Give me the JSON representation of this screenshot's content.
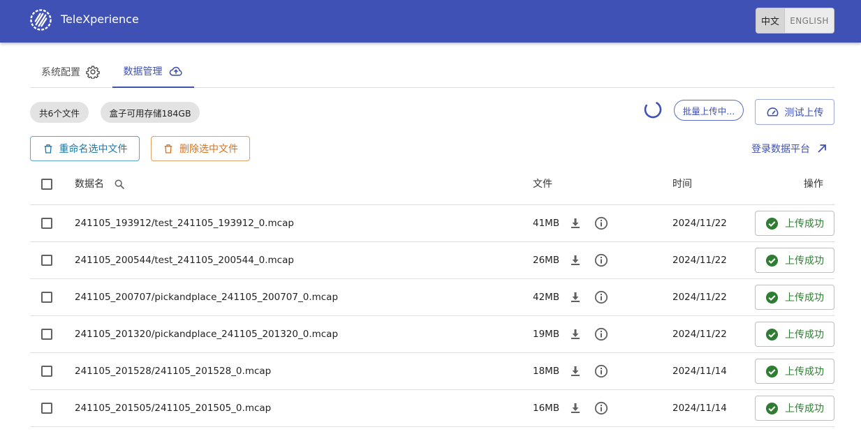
{
  "app": {
    "title": "TeleXperience"
  },
  "language": {
    "options": [
      "中文",
      "ENGLISH"
    ],
    "selected": "中文"
  },
  "tabs": [
    {
      "label": "系统配置",
      "icon": "gear-icon",
      "active": false
    },
    {
      "label": "数据管理",
      "icon": "cloud-upload-icon",
      "active": true
    }
  ],
  "summary": {
    "file_count": "共6个文件",
    "storage": "盒子可用存储184GB"
  },
  "upload": {
    "batch_label": "批量上传中...",
    "test_label": "测试上传"
  },
  "actions": {
    "rename_label": "重命名选中文件",
    "delete_label": "删除选中文件",
    "login_label": "登录数据平台"
  },
  "table": {
    "headers": {
      "name": "数据名",
      "file": "文件",
      "time": "时间",
      "op": "操作"
    },
    "rows": [
      {
        "name": "241105_193912/test_241105_193912_0.mcap",
        "size": "41MB",
        "time": "2024/11/22",
        "status": "上传成功"
      },
      {
        "name": "241105_200544/test_241105_200544_0.mcap",
        "size": "26MB",
        "time": "2024/11/22",
        "status": "上传成功"
      },
      {
        "name": "241105_200707/pickandplace_241105_200707_0.mcap",
        "size": "42MB",
        "time": "2024/11/22",
        "status": "上传成功"
      },
      {
        "name": "241105_201320/pickandplace_241105_201320_0.mcap",
        "size": "19MB",
        "time": "2024/11/22",
        "status": "上传成功"
      },
      {
        "name": "241105_201528/241105_201528_0.mcap",
        "size": "18MB",
        "time": "2024/11/14",
        "status": "上传成功"
      },
      {
        "name": "241105_201505/241105_201505_0.mcap",
        "size": "16MB",
        "time": "2024/11/14",
        "status": "上传成功"
      }
    ]
  },
  "colors": {
    "primary": "#3f51b5",
    "success": "#2e7d32",
    "rename": "#1f7aa8",
    "delete": "#d9731f"
  }
}
